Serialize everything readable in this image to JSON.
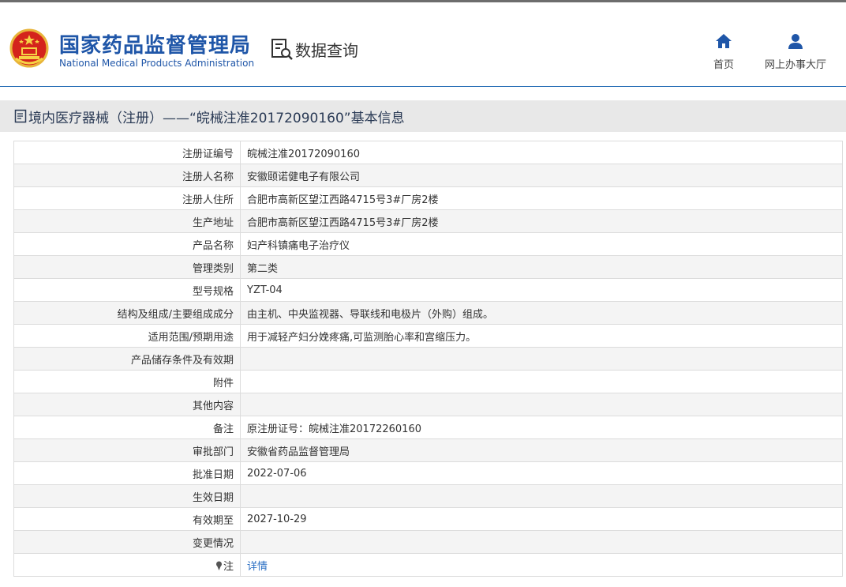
{
  "header": {
    "org_cn": "国家药品监督管理局",
    "org_en": "National Medical Products Administration",
    "section_label": "数据查询",
    "nav": [
      {
        "label": "首页",
        "icon": "home-icon"
      },
      {
        "label": "网上办事大厅",
        "icon": "user-icon"
      }
    ]
  },
  "title_bar": {
    "text": "境内医疗器械（注册）——“皖械注准20172090160”基本信息",
    "icon": "document-icon"
  },
  "rows": [
    {
      "key": "注册证编号",
      "value": "皖械注准20172090160"
    },
    {
      "key": "注册人名称",
      "value": "安徽颐诺健电子有限公司"
    },
    {
      "key": "注册人住所",
      "value": "合肥市高新区望江西路4715号3#厂房2楼"
    },
    {
      "key": "生产地址",
      "value": "合肥市高新区望江西路4715号3#厂房2楼"
    },
    {
      "key": "产品名称",
      "value": "妇产科镇痛电子治疗仪"
    },
    {
      "key": "管理类别",
      "value": "第二类"
    },
    {
      "key": "型号规格",
      "value": "YZT-04"
    },
    {
      "key": "结构及组成/主要组成成分",
      "value": "由主机、中央监视器、导联线和电极片（外购）组成。"
    },
    {
      "key": "适用范围/预期用途",
      "value": "用于减轻产妇分娩疼痛,可监测胎心率和宫缩压力。"
    },
    {
      "key": "产品储存条件及有效期",
      "value": ""
    },
    {
      "key": "附件",
      "value": ""
    },
    {
      "key": "其他内容",
      "value": ""
    },
    {
      "key": "备注",
      "value": "原注册证号：皖械注准20172260160"
    },
    {
      "key": "审批部门",
      "value": "安徽省药品监督管理局"
    },
    {
      "key": "批准日期",
      "value": "2022-07-06"
    },
    {
      "key": "生效日期",
      "value": ""
    },
    {
      "key": "有效期至",
      "value": "2027-10-29"
    },
    {
      "key": "变更情况",
      "value": ""
    }
  ],
  "note_row": {
    "key": "注",
    "link_text": "详情"
  },
  "colors": {
    "brand_blue": "#1f56a8",
    "link_blue": "#2b6fc3",
    "title_bar_bg": "#e8e8e8"
  }
}
